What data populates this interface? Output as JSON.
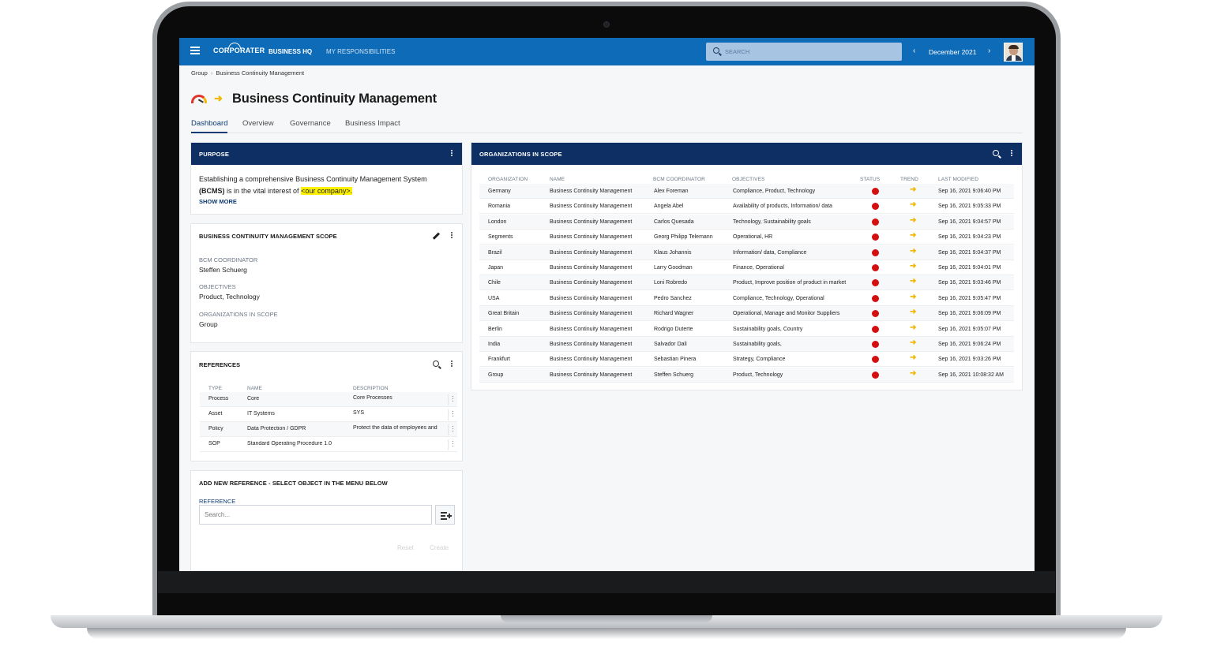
{
  "topbar": {
    "logo_text": "CORPORATER",
    "nav": [
      "BUSINESS HQ",
      "MY RESPONSIBILITIES"
    ],
    "search_placeholder": "SEARCH",
    "period": "December 2021",
    "prev_symbol": "‹",
    "next_symbol": "›"
  },
  "breadcrumb": [
    "Group",
    "Business Continuity Management"
  ],
  "breadcrumb_sep": "›",
  "page": {
    "title": "Business Continuity Management",
    "trend_symbol": "➜",
    "gauge_colors": [
      "#e0342b",
      "#f2b705"
    ]
  },
  "tabs": [
    "Dashboard",
    "Overview",
    "Governance",
    "Business Impact"
  ],
  "active_tab": "Dashboard",
  "purpose": {
    "heading": "PURPOSE",
    "text_before": "Establishing a comprehensive Business Continuity Management System",
    "text_bold": "(BCMS)",
    "text_mid": "is in the vital interest of",
    "text_highlight": "<our company>.",
    "show_more": "SHOW MORE"
  },
  "scope": {
    "heading": "BUSINESS CONTINUITY MANAGEMENT SCOPE",
    "fields": [
      {
        "label": "BCM COORDINATOR",
        "value": "Steffen Schuerg"
      },
      {
        "label": "OBJECTIVES",
        "value": "Product, Technology"
      },
      {
        "label": "ORGANIZATIONS IN SCOPE",
        "value": "Group"
      }
    ]
  },
  "references": {
    "heading": "REFERENCES",
    "columns": [
      "TYPE",
      "NAME",
      "DESCRIPTION"
    ],
    "rows": [
      {
        "type": "Process",
        "name": "Core",
        "description": "Core Processes"
      },
      {
        "type": "Asset",
        "name": "IT Systems",
        "description": "SYS"
      },
      {
        "type": "Policy",
        "name": "Data Protection / GDPR",
        "description": "Protect the data of employees and"
      },
      {
        "type": "SOP",
        "name": "Standard Operating Procedure 1.0",
        "description": ""
      }
    ]
  },
  "add_reference": {
    "heading": "ADD NEW REFERENCE - SELECT OBJECT IN THE MENU BELOW",
    "label": "REFERENCE",
    "placeholder": "Search...",
    "reset": "Reset",
    "create": "Create"
  },
  "orgs": {
    "heading": "ORGANIZATIONS IN SCOPE",
    "columns": [
      "ORGANIZATION",
      "NAME",
      "BCM COORDINATOR",
      "OBJECTIVES",
      "STATUS",
      "TREND",
      "LAST MODIFIED"
    ],
    "status_color": "#d50f0f",
    "trend_color": "#f2b705",
    "trend_symbol": "➜",
    "rows": [
      {
        "org": "Germany",
        "name": "Business Continuity Management",
        "coordinator": "Alex Foreman",
        "objectives": "Compliance, Product, Technology",
        "status": "red",
        "trend": "flat",
        "modified": "Sep 16, 2021 9:06:40 PM"
      },
      {
        "org": "Romania",
        "name": "Business Continuity Management",
        "coordinator": "Angela Abel",
        "objectives": "Availability of products, Information/ data",
        "status": "red",
        "trend": "flat",
        "modified": "Sep 16, 2021 9:05:33 PM"
      },
      {
        "org": "London",
        "name": "Business Continuity Management",
        "coordinator": "Carlos Quesada",
        "objectives": "Technology, Sustainability goals",
        "status": "red",
        "trend": "flat",
        "modified": "Sep 16, 2021 9:04:57 PM"
      },
      {
        "org": "Segments",
        "name": "Business Continuity Management",
        "coordinator": "Georg Philipp Telemann",
        "objectives": "Operational, HR",
        "status": "red",
        "trend": "flat",
        "modified": "Sep 16, 2021 9:04:23 PM"
      },
      {
        "org": "Brazil",
        "name": "Business Continuity Management",
        "coordinator": "Klaus Johannis",
        "objectives": "Information/ data, Compliance",
        "status": "red",
        "trend": "flat",
        "modified": "Sep 16, 2021 9:04:37 PM"
      },
      {
        "org": "Japan",
        "name": "Business Continuity Management",
        "coordinator": "Larry Goodman",
        "objectives": "Finance, Operational",
        "status": "red",
        "trend": "flat",
        "modified": "Sep 16, 2021 9:04:01 PM"
      },
      {
        "org": "Chile",
        "name": "Business Continuity Management",
        "coordinator": "Loni Robredo",
        "objectives": "Product, Improve position of product in market",
        "status": "red",
        "trend": "flat",
        "modified": "Sep 16, 2021 9:03:46 PM"
      },
      {
        "org": "USA",
        "name": "Business Continuity Management",
        "coordinator": "Pedro Sanchez",
        "objectives": "Compliance, Technology, Operational",
        "status": "red",
        "trend": "flat",
        "modified": "Sep 16, 2021 9:05:47 PM"
      },
      {
        "org": "Great Britain",
        "name": "Business Continuity Management",
        "coordinator": "Richard Wagner",
        "objectives": "Operational, Manage and Monitor Suppliers",
        "status": "red",
        "trend": "flat",
        "modified": "Sep 16, 2021 9:06:09 PM"
      },
      {
        "org": "Berlin",
        "name": "Business Continuity Management",
        "coordinator": "Rodrigo Duterte",
        "objectives": "Sustainability goals, Country",
        "status": "red",
        "trend": "flat",
        "modified": "Sep 16, 2021 9:05:07 PM"
      },
      {
        "org": "India",
        "name": "Business Continuity Management",
        "coordinator": "Salvador Dali",
        "objectives": "Sustainability goals,",
        "status": "red",
        "trend": "flat",
        "modified": "Sep 16, 2021 9:06:24 PM"
      },
      {
        "org": "Frankfurt",
        "name": "Business Continuity Management",
        "coordinator": "Sebastian Pinera",
        "objectives": "Strategy, Compliance",
        "status": "red",
        "trend": "flat",
        "modified": "Sep 16, 2021 9:03:26 PM"
      },
      {
        "org": "Group",
        "name": "Business Continuity Management",
        "coordinator": "Steffen Schuerg",
        "objectives": "Product, Technology",
        "status": "red",
        "trend": "flat",
        "modified": "Sep 16, 2021 10:08:32 AM"
      }
    ]
  }
}
